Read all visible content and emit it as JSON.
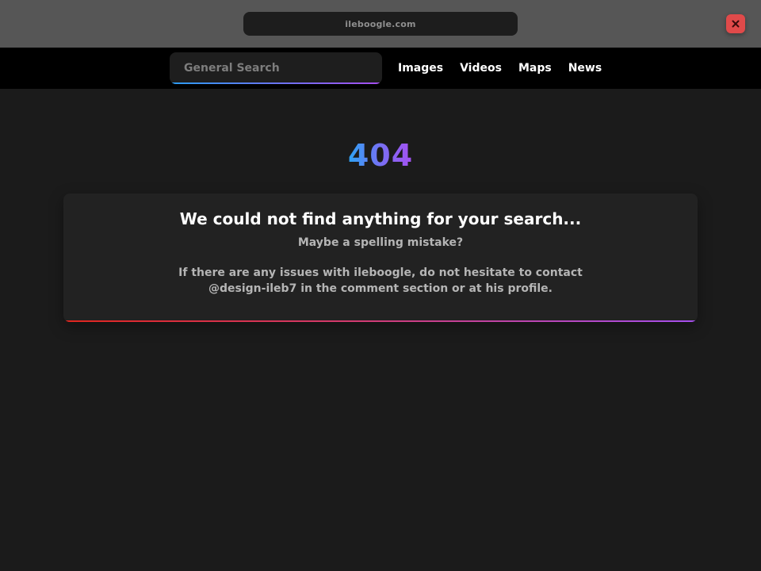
{
  "browser": {
    "url": "ileboogle.com",
    "close_icon": "close-icon",
    "close_color": "#e04a4a"
  },
  "nav": {
    "search_placeholder": "General Search",
    "search_value": "",
    "links": [
      {
        "label": "Images"
      },
      {
        "label": "Videos"
      },
      {
        "label": "Maps"
      },
      {
        "label": "News"
      }
    ],
    "accent_gradient": [
      "#2c9cf2",
      "#a64df0"
    ]
  },
  "main": {
    "error_code": "404",
    "title": "We could not find anything for your search...",
    "subtitle": "Maybe a spelling mistake?",
    "body": "If there are any issues with ileboogle, do not hesitate to contact @design-ileb7 in the comment section or at his profile.",
    "card_border_gradient": [
      "#e0261e",
      "#a54fee"
    ]
  }
}
